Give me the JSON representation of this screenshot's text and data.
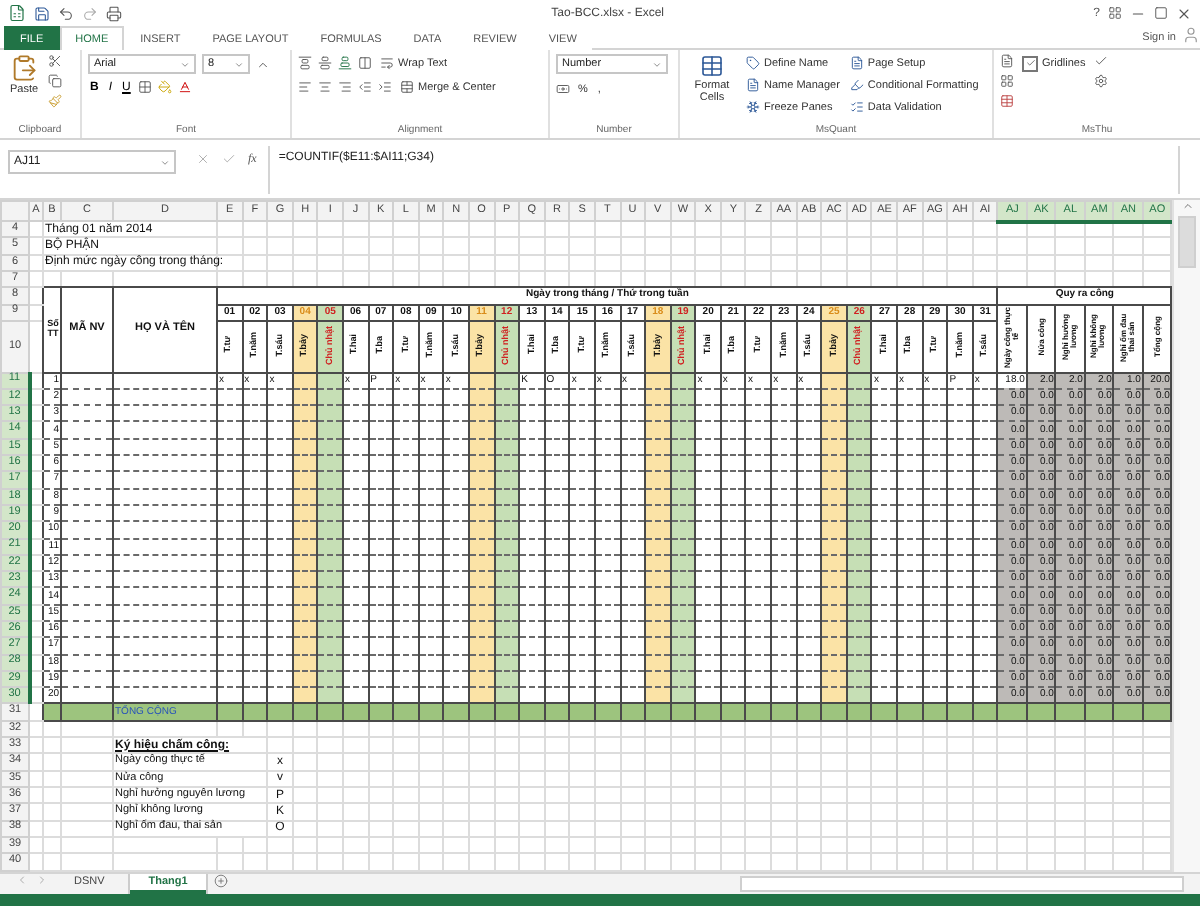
{
  "window": {
    "title": "Tao-BCC.xlsx - Excel",
    "help": "?"
  },
  "tabs": [
    {
      "label": "FILE",
      "kind": "file",
      "selected": false
    },
    {
      "label": "HOME",
      "kind": "tab",
      "selected": true
    },
    {
      "label": "INSERT",
      "kind": "tab",
      "selected": false
    },
    {
      "label": "PAGE LAYOUT",
      "kind": "tab",
      "selected": false
    },
    {
      "label": "FORMULAS",
      "kind": "tab",
      "selected": false
    },
    {
      "label": "DATA",
      "kind": "tab",
      "selected": false
    },
    {
      "label": "REVIEW",
      "kind": "tab",
      "selected": false
    },
    {
      "label": "VIEW",
      "kind": "tab",
      "selected": false
    }
  ],
  "account": {
    "label": "Sign in"
  },
  "ribbon": {
    "clipboard": {
      "paste": "Paste",
      "label": "Clipboard"
    },
    "font": {
      "name": "Arial",
      "size": "8",
      "bold": "B",
      "italic": "I",
      "underline": "U",
      "label": "Font"
    },
    "alignment": {
      "wrap": "Wrap Text",
      "merge": "Merge & Center",
      "label": "Alignment"
    },
    "number": {
      "format": "Number",
      "percent": "%",
      "comma": ",",
      "label": "Number"
    },
    "misc": {
      "format_cells": "Format Cells",
      "items": [
        "Define Name",
        "Name Manager",
        "Freeze Panes",
        "Page Setup",
        "Conditional Formatting",
        "Data Validation"
      ],
      "label": "MsQuant"
    },
    "view": {
      "gridlines": {
        "label": "Gridlines",
        "checked": true
      },
      "label": "MsThu"
    }
  },
  "formula_bar": {
    "name_box": "AJ11",
    "function_label": "fx",
    "formula": "=COUNTIF($E11:$AI11;G34)"
  },
  "sheet": {
    "columns": [
      {
        "label": "A",
        "selected": false
      },
      {
        "label": "B",
        "selected": false
      },
      {
        "label": "C",
        "selected": false
      },
      {
        "label": "D",
        "selected": false
      },
      {
        "label": "E",
        "selected": false
      },
      {
        "label": "F",
        "selected": false
      },
      {
        "label": "G",
        "selected": false
      },
      {
        "label": "H",
        "selected": false
      },
      {
        "label": "I",
        "selected": false
      },
      {
        "label": "J",
        "selected": false
      },
      {
        "label": "K",
        "selected": false
      },
      {
        "label": "L",
        "selected": false
      },
      {
        "label": "M",
        "selected": false
      },
      {
        "label": "N",
        "selected": false
      },
      {
        "label": "O",
        "selected": false
      },
      {
        "label": "P",
        "selected": false
      },
      {
        "label": "Q",
        "selected": false
      },
      {
        "label": "R",
        "selected": false
      },
      {
        "label": "S",
        "selected": false
      },
      {
        "label": "T",
        "selected": false
      },
      {
        "label": "U",
        "selected": false
      },
      {
        "label": "V",
        "selected": false
      },
      {
        "label": "W",
        "selected": false
      },
      {
        "label": "X",
        "selected": false
      },
      {
        "label": "Y",
        "selected": false
      },
      {
        "label": "Z",
        "selected": false
      },
      {
        "label": "AA",
        "selected": false
      },
      {
        "label": "AB",
        "selected": false
      },
      {
        "label": "AC",
        "selected": false
      },
      {
        "label": "AD",
        "selected": false
      },
      {
        "label": "AE",
        "selected": false
      },
      {
        "label": "AF",
        "selected": false
      },
      {
        "label": "AG",
        "selected": false
      },
      {
        "label": "AH",
        "selected": false
      },
      {
        "label": "AI",
        "selected": false
      },
      {
        "label": "AJ",
        "selected": true
      },
      {
        "label": "AK",
        "selected": true
      },
      {
        "label": "AL",
        "selected": true
      },
      {
        "label": "AM",
        "selected": true
      },
      {
        "label": "AN",
        "selected": true
      },
      {
        "label": "AO",
        "selected": true
      }
    ],
    "rows": [
      {
        "label": "4",
        "selected": false
      },
      {
        "label": "5",
        "selected": false
      },
      {
        "label": "6",
        "selected": false
      },
      {
        "label": "7",
        "selected": false
      },
      {
        "label": "8",
        "selected": false
      },
      {
        "label": "9",
        "selected": false
      },
      {
        "label": "10",
        "selected": false
      },
      {
        "label": "11",
        "selected": true
      },
      {
        "label": "12",
        "selected": true
      },
      {
        "label": "13",
        "selected": true
      },
      {
        "label": "14",
        "selected": true
      },
      {
        "label": "15",
        "selected": true
      },
      {
        "label": "16",
        "selected": true
      },
      {
        "label": "17",
        "selected": true
      },
      {
        "label": "18",
        "selected": true
      },
      {
        "label": "19",
        "selected": true
      },
      {
        "label": "20",
        "selected": true
      },
      {
        "label": "21",
        "selected": true
      },
      {
        "label": "22",
        "selected": true
      },
      {
        "label": "23",
        "selected": true
      },
      {
        "label": "24",
        "selected": true
      },
      {
        "label": "25",
        "selected": true
      },
      {
        "label": "26",
        "selected": true
      },
      {
        "label": "27",
        "selected": true
      },
      {
        "label": "28",
        "selected": true
      },
      {
        "label": "29",
        "selected": true
      },
      {
        "label": "30",
        "selected": true
      },
      {
        "label": "31",
        "selected": false
      },
      {
        "label": "32",
        "selected": false
      },
      {
        "label": "33",
        "selected": false
      },
      {
        "label": "34",
        "selected": false
      },
      {
        "label": "35",
        "selected": false
      },
      {
        "label": "36",
        "selected": false
      },
      {
        "label": "37",
        "selected": false
      },
      {
        "label": "38",
        "selected": false
      },
      {
        "label": "39",
        "selected": false
      },
      {
        "label": "40",
        "selected": false
      }
    ],
    "title": "Tháng 01 năm 2014",
    "department": "BỘ PHẬN",
    "quota": "Định mức ngày công trong tháng:",
    "table": {
      "no_header": "Số TT",
      "id_header": "MÃ NV",
      "name_header": "HỌ VÀ TÊN",
      "days_header": "Ngày trong tháng / Thứ trong tuần",
      "totals_header": "Quy ra công",
      "days": [
        {
          "day": "01",
          "weekday": "T.tư",
          "kind": "weekday"
        },
        {
          "day": "02",
          "weekday": "T.năm",
          "kind": "weekday"
        },
        {
          "day": "03",
          "weekday": "T.sáu",
          "kind": "weekday"
        },
        {
          "day": "04",
          "weekday": "T.bảy",
          "kind": "saturday"
        },
        {
          "day": "05",
          "weekday": "Chủ nhật",
          "kind": "sunday"
        },
        {
          "day": "06",
          "weekday": "T.hai",
          "kind": "weekday"
        },
        {
          "day": "07",
          "weekday": "T.ba",
          "kind": "weekday"
        },
        {
          "day": "08",
          "weekday": "T.tư",
          "kind": "weekday"
        },
        {
          "day": "09",
          "weekday": "T.năm",
          "kind": "weekday"
        },
        {
          "day": "10",
          "weekday": "T.sáu",
          "kind": "weekday"
        },
        {
          "day": "11",
          "weekday": "T.bảy",
          "kind": "saturday"
        },
        {
          "day": "12",
          "weekday": "Chủ nhật",
          "kind": "sunday"
        },
        {
          "day": "13",
          "weekday": "T.hai",
          "kind": "weekday"
        },
        {
          "day": "14",
          "weekday": "T.ba",
          "kind": "weekday"
        },
        {
          "day": "15",
          "weekday": "T.tư",
          "kind": "weekday"
        },
        {
          "day": "16",
          "weekday": "T.năm",
          "kind": "weekday"
        },
        {
          "day": "17",
          "weekday": "T.sáu",
          "kind": "weekday"
        },
        {
          "day": "18",
          "weekday": "T.bảy",
          "kind": "saturday"
        },
        {
          "day": "19",
          "weekday": "Chủ nhật",
          "kind": "sunday"
        },
        {
          "day": "20",
          "weekday": "T.hai",
          "kind": "weekday"
        },
        {
          "day": "21",
          "weekday": "T.ba",
          "kind": "weekday"
        },
        {
          "day": "22",
          "weekday": "T.tư",
          "kind": "weekday"
        },
        {
          "day": "23",
          "weekday": "T.năm",
          "kind": "weekday"
        },
        {
          "day": "24",
          "weekday": "T.sáu",
          "kind": "weekday"
        },
        {
          "day": "25",
          "weekday": "T.bảy",
          "kind": "saturday"
        },
        {
          "day": "26",
          "weekday": "Chủ nhật",
          "kind": "sunday"
        },
        {
          "day": "27",
          "weekday": "T.hai",
          "kind": "weekday"
        },
        {
          "day": "28",
          "weekday": "T.ba",
          "kind": "weekday"
        },
        {
          "day": "29",
          "weekday": "T.tư",
          "kind": "weekday"
        },
        {
          "day": "30",
          "weekday": "T.năm",
          "kind": "weekday"
        },
        {
          "day": "31",
          "weekday": "T.sáu",
          "kind": "weekday"
        }
      ],
      "totals_columns": [
        "Ngày công thực tế",
        "Nửa công",
        "Nghỉ hưởng lương",
        "Nghỉ không lương",
        "Nghỉ ốm đau thai sản",
        "Tổng cộng"
      ],
      "employees": [
        {
          "no": "1",
          "marks": {
            "1": "x",
            "2": "x",
            "3": "x",
            "6": "x",
            "7": "P",
            "8": "x",
            "9": "x",
            "10": "x",
            "13": "K",
            "14": "O",
            "15": "x",
            "16": "x",
            "17": "x",
            "20": "x",
            "21": "x",
            "22": "x",
            "23": "x",
            "24": "x",
            "27": "x",
            "28": "x",
            "29": "x",
            "30": "P",
            "31": "x"
          },
          "totals": [
            "18.0",
            "2.0",
            "2.0",
            "2.0",
            "1.0",
            "20.0"
          ]
        },
        {
          "no": "2",
          "totals": [
            "0.0",
            "0.0",
            "0.0",
            "0.0",
            "0.0",
            "0.0"
          ]
        },
        {
          "no": "3",
          "totals": [
            "0.0",
            "0.0",
            "0.0",
            "0.0",
            "0.0",
            "0.0"
          ]
        },
        {
          "no": "4",
          "totals": [
            "0.0",
            "0.0",
            "0.0",
            "0.0",
            "0.0",
            "0.0"
          ]
        },
        {
          "no": "5",
          "totals": [
            "0.0",
            "0.0",
            "0.0",
            "0.0",
            "0.0",
            "0.0"
          ]
        },
        {
          "no": "6",
          "totals": [
            "0.0",
            "0.0",
            "0.0",
            "0.0",
            "0.0",
            "0.0"
          ]
        },
        {
          "no": "7",
          "totals": [
            "0.0",
            "0.0",
            "0.0",
            "0.0",
            "0.0",
            "0.0"
          ]
        },
        {
          "no": "8",
          "totals": [
            "0.0",
            "0.0",
            "0.0",
            "0.0",
            "0.0",
            "0.0"
          ]
        },
        {
          "no": "9",
          "totals": [
            "0.0",
            "0.0",
            "0.0",
            "0.0",
            "0.0",
            "0.0"
          ]
        },
        {
          "no": "10",
          "totals": [
            "0.0",
            "0.0",
            "0.0",
            "0.0",
            "0.0",
            "0.0"
          ]
        },
        {
          "no": "11",
          "totals": [
            "0.0",
            "0.0",
            "0.0",
            "0.0",
            "0.0",
            "0.0"
          ]
        },
        {
          "no": "12",
          "totals": [
            "0.0",
            "0.0",
            "0.0",
            "0.0",
            "0.0",
            "0.0"
          ]
        },
        {
          "no": "13",
          "totals": [
            "0.0",
            "0.0",
            "0.0",
            "0.0",
            "0.0",
            "0.0"
          ]
        },
        {
          "no": "14",
          "totals": [
            "0.0",
            "0.0",
            "0.0",
            "0.0",
            "0.0",
            "0.0"
          ]
        },
        {
          "no": "15",
          "totals": [
            "0.0",
            "0.0",
            "0.0",
            "0.0",
            "0.0",
            "0.0"
          ]
        },
        {
          "no": "16",
          "totals": [
            "0.0",
            "0.0",
            "0.0",
            "0.0",
            "0.0",
            "0.0"
          ]
        },
        {
          "no": "17",
          "totals": [
            "0.0",
            "0.0",
            "0.0",
            "0.0",
            "0.0",
            "0.0"
          ]
        },
        {
          "no": "18",
          "totals": [
            "0.0",
            "0.0",
            "0.0",
            "0.0",
            "0.0",
            "0.0"
          ]
        },
        {
          "no": "19",
          "totals": [
            "0.0",
            "0.0",
            "0.0",
            "0.0",
            "0.0",
            "0.0"
          ]
        },
        {
          "no": "20",
          "totals": [
            "0.0",
            "0.0",
            "0.0",
            "0.0",
            "0.0",
            "0.0"
          ]
        }
      ],
      "total_label": "TỔNG CỘNG"
    },
    "legend": {
      "title": "Ký hiệu chấm công:",
      "items": [
        {
          "label": "Ngày công thực tế",
          "symbol": "x"
        },
        {
          "label": "Nửa công",
          "symbol": "v"
        },
        {
          "label": "Nghỉ hưởng nguyên lương",
          "symbol": "P"
        },
        {
          "label": "Nghỉ không lương",
          "symbol": "K"
        },
        {
          "label": "Nghỉ ốm đau, thai sản",
          "symbol": "O"
        }
      ]
    }
  },
  "sheet_tabs": [
    {
      "label": "DSNV",
      "selected": false
    },
    {
      "label": "Thang1",
      "selected": true
    }
  ]
}
